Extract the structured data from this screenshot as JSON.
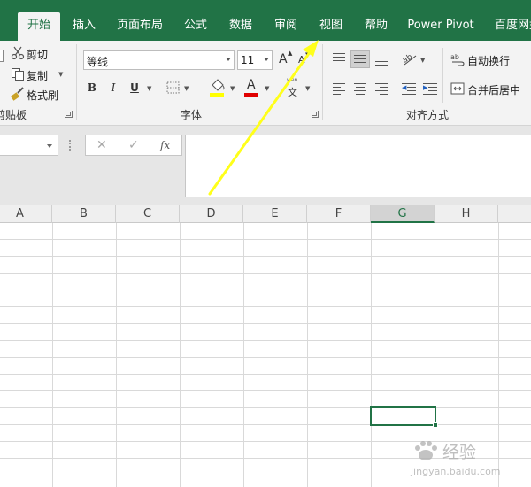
{
  "tabs": [
    {
      "label": "开始",
      "active": true
    },
    {
      "label": "插入"
    },
    {
      "label": "页面布局"
    },
    {
      "label": "公式"
    },
    {
      "label": "数据"
    },
    {
      "label": "审阅"
    },
    {
      "label": "视图"
    },
    {
      "label": "帮助"
    },
    {
      "label": "Power Pivot"
    },
    {
      "label": "百度网盘"
    }
  ],
  "clipboard": {
    "cut": "剪切",
    "copy": "复制",
    "format_painter": "格式刷",
    "group_label": "剪贴板"
  },
  "font": {
    "name": "等线",
    "size": "11",
    "bold": "B",
    "italic": "I",
    "underline": "U",
    "grow_glyph": "A",
    "shrink_glyph": "A",
    "color_glyph": "A",
    "phonetic_top": "wén",
    "phonetic_bottom": "文",
    "group_label": "字体"
  },
  "alignment": {
    "wrap_text": "自动换行",
    "merge_center": "合并后居中",
    "group_label": "对齐方式"
  },
  "formula_bar": {
    "cancel": "✕",
    "enter": "✓",
    "fx": "fx",
    "value": ""
  },
  "columns": [
    "A",
    "B",
    "C",
    "D",
    "E",
    "F",
    "G",
    "H"
  ],
  "selected_column": "G",
  "colors": {
    "brand_green": "#217346",
    "highlight_yellow": "#ffff00",
    "font_red": "#e00000",
    "arrow_yellow": "#ffff1a"
  },
  "watermark": {
    "text": "经验",
    "url": "jingyan.baidu.com"
  }
}
